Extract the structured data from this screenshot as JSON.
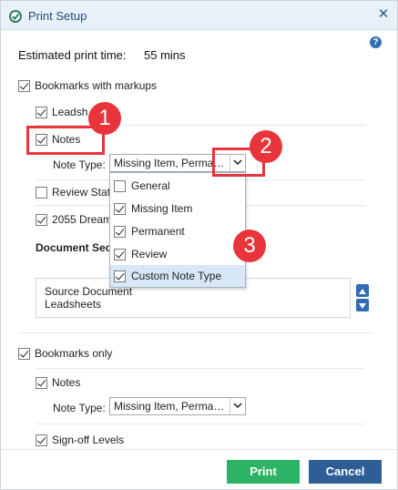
{
  "window": {
    "title": "Print Setup",
    "close_glyph": "✕",
    "help_glyph": "?"
  },
  "estimate": {
    "label": "Estimated print time:",
    "value": "55 mins"
  },
  "bookmarks_with_markups": {
    "label": "Bookmarks with markups",
    "checked": true,
    "items": {
      "leadsheets": {
        "label": "Leadsh",
        "checked": true
      },
      "notes": {
        "label": "Notes",
        "checked": true
      },
      "note_type_label": "Note Type:",
      "note_type_value": "Missing Item, Perma…",
      "review_status": {
        "label": "Review Stat",
        "checked": false
      },
      "dream": {
        "label": "2055 Dream",
        "checked": true
      }
    },
    "document_section_label": "Document Sec",
    "documents": [
      "Source Document",
      "Leadsheets"
    ]
  },
  "note_type_dropdown": {
    "options": [
      {
        "label": "General",
        "checked": false,
        "selected": false
      },
      {
        "label": "Missing Item",
        "checked": true,
        "selected": false
      },
      {
        "label": "Permanent",
        "checked": true,
        "selected": false
      },
      {
        "label": "Review",
        "checked": true,
        "selected": false
      },
      {
        "label": "Custom Note Type",
        "checked": true,
        "selected": true
      }
    ]
  },
  "bookmarks_only": {
    "label": "Bookmarks only",
    "checked": true,
    "notes": {
      "label": "Notes",
      "checked": true
    },
    "note_type_label": "Note Type:",
    "note_type_value": "Missing Item, Perma…",
    "signoff": {
      "label": "Sign-off Levels",
      "checked": true
    }
  },
  "callouts": [
    "1",
    "2",
    "3"
  ],
  "footer": {
    "print_label": "Print",
    "cancel_label": "Cancel"
  },
  "colors": {
    "accent": "#2d5e96",
    "print_button": "#2cb365",
    "callout_red": "#e8353b",
    "titlebar": "#e8f0f8"
  },
  "icons": {
    "app": "green-check-circle-icon",
    "close": "close-icon",
    "help": "help-icon",
    "chevron": "chevron-down-icon",
    "scroll_up": "arrow-up-icon",
    "scroll_down": "arrow-down-icon"
  }
}
